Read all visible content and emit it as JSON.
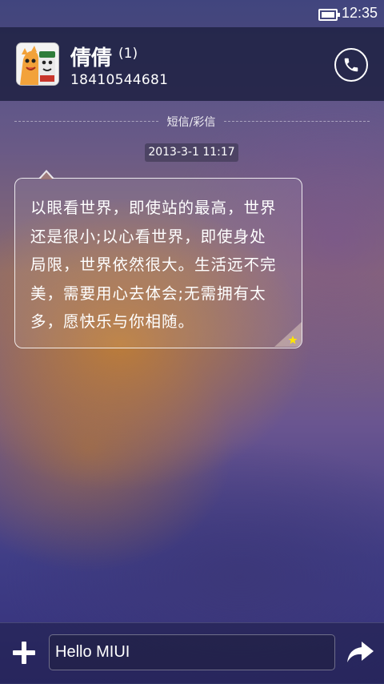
{
  "status_bar": {
    "time": "12:35",
    "battery_icon": "battery-icon"
  },
  "header": {
    "contact_name": "倩倩",
    "unread_count": "(1)",
    "phone_number": "18410544681",
    "avatar_icon": "cartoon-avatar",
    "call_icon": "phone-icon"
  },
  "conversation": {
    "type_label": "短信/彩信",
    "timestamp": "2013-3-1 11:17",
    "message_lines": [
      "以眼看世界，即使站的最高，世界",
      "还是很小;以心看世界，即使身处",
      "局限，世界依然很大。生活远不完",
      "美，需要用心去体会;无需拥有太",
      "多，愿快乐与你相随。"
    ]
  },
  "composer": {
    "input_value": "Hello MIUI",
    "add_icon": "plus-icon",
    "send_icon": "forward-arrow-icon"
  },
  "colors": {
    "star": "#ffe600",
    "header_bg": "#1c1e3e"
  }
}
